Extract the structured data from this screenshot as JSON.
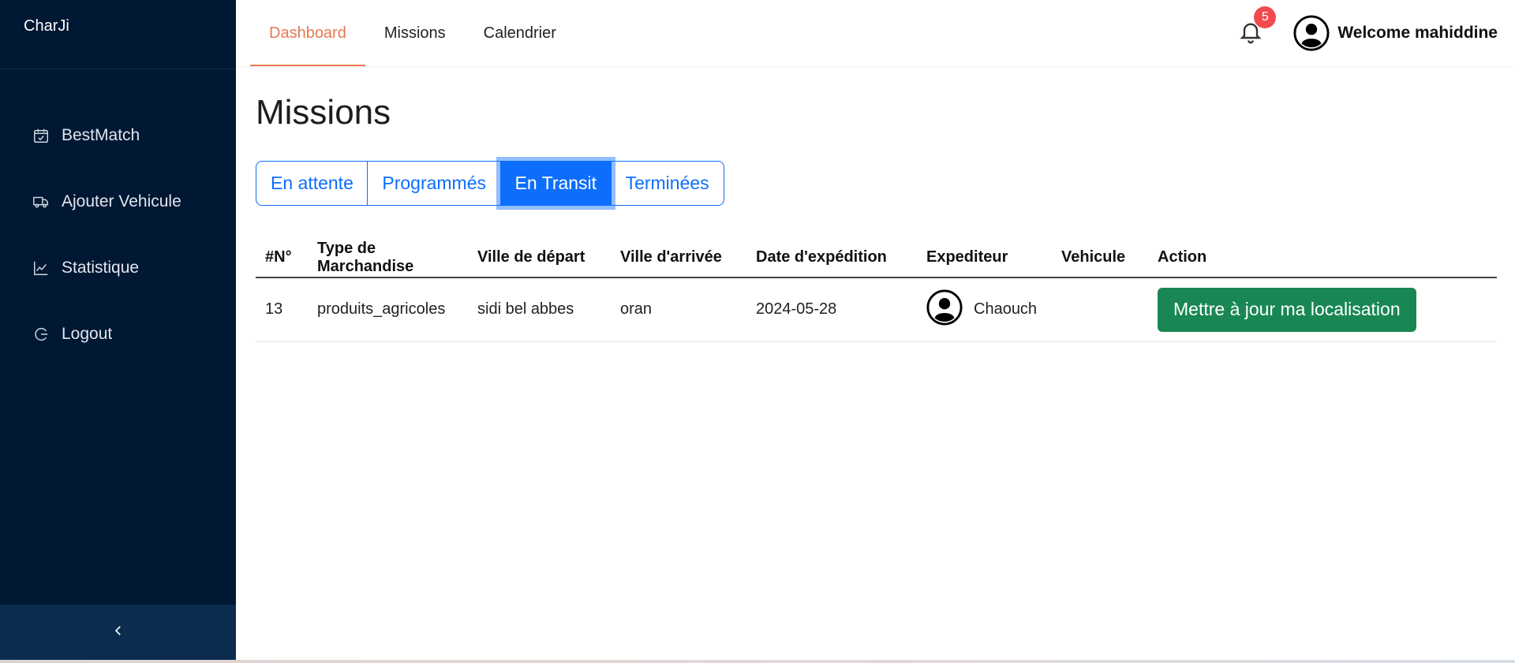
{
  "brand": "CharJi",
  "sidebar": {
    "items": [
      {
        "label": "BestMatch",
        "icon": "calendar-check-icon"
      },
      {
        "label": "Ajouter Vehicule",
        "icon": "truck-icon"
      },
      {
        "label": "Statistique",
        "icon": "chart-line-icon"
      },
      {
        "label": "Logout",
        "icon": "logout-icon"
      }
    ],
    "collapse_icon": "chevron-left-icon"
  },
  "topbar": {
    "tabs": [
      {
        "label": "Dashboard",
        "active": true
      },
      {
        "label": "Missions",
        "active": false
      },
      {
        "label": "Calendrier",
        "active": false
      }
    ],
    "notification_count": "5",
    "welcome": "Welcome mahiddine"
  },
  "page": {
    "title": "Missions",
    "filters": [
      {
        "label": "En attente",
        "active": false
      },
      {
        "label": "Programmés",
        "active": false
      },
      {
        "label": "En Transit",
        "active": true
      },
      {
        "label": "Terminées",
        "active": false
      }
    ]
  },
  "table": {
    "headers": [
      "#N°",
      "Type de Marchandise",
      "Ville de départ",
      "Ville d'arrivée",
      "Date d'expédition",
      "Expediteur",
      "Vehicule",
      "Action"
    ],
    "rows": [
      {
        "num": "13",
        "type": "produits_agricoles",
        "depart": "sidi bel abbes",
        "arrivee": "oran",
        "date": "2024-05-28",
        "expediteur": "Chaouch",
        "vehicule": "",
        "action": "Mettre à jour ma localisation"
      }
    ]
  },
  "colors": {
    "sidebar_bg": "#001833",
    "accent_orange": "#e9784f",
    "primary_blue": "#0d6efd",
    "success_green": "#198754",
    "badge_red": "#f24a4f"
  }
}
